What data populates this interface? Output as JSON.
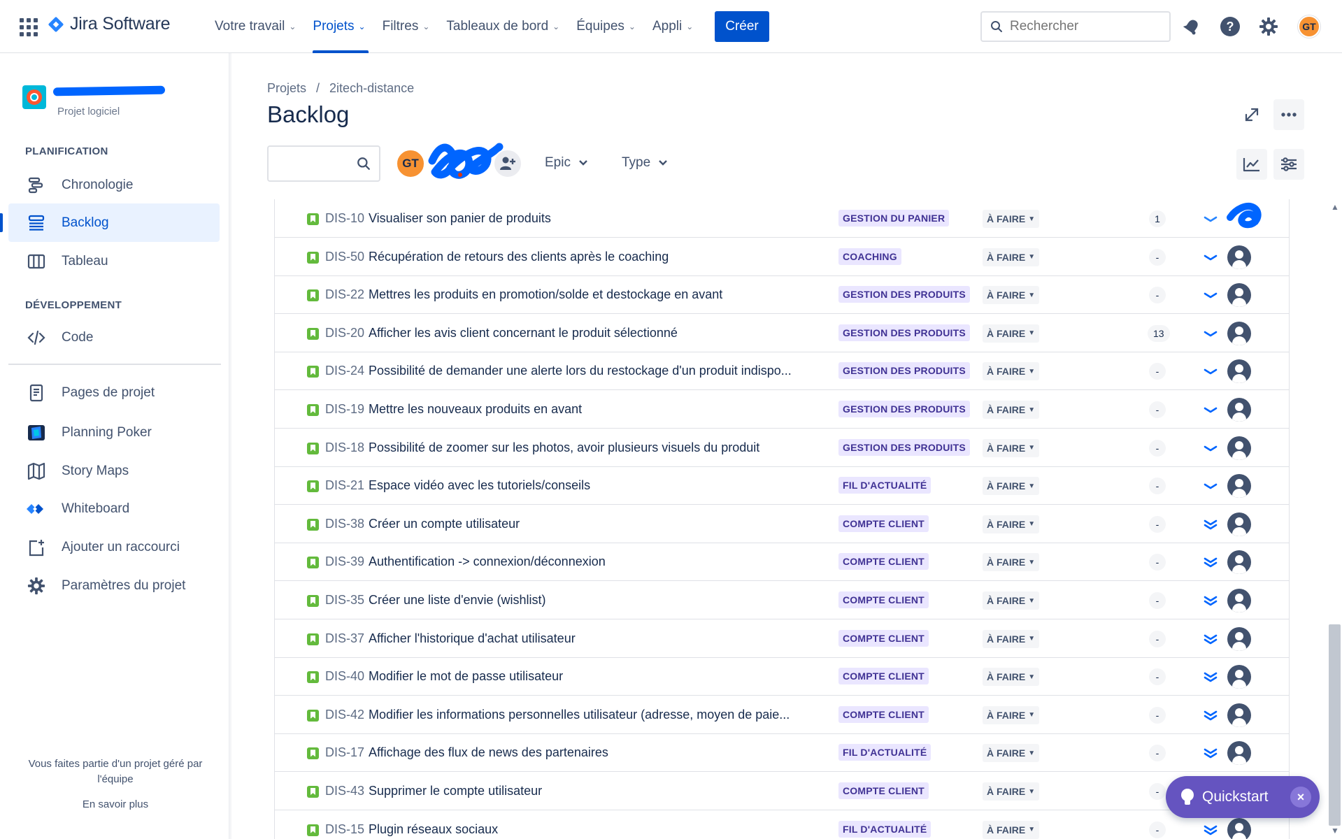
{
  "topnav": {
    "product": "Jira Software",
    "items": [
      {
        "label": "Votre travail"
      },
      {
        "label": "Projets"
      },
      {
        "label": "Filtres"
      },
      {
        "label": "Tableaux de bord"
      },
      {
        "label": "Équipes"
      },
      {
        "label": "Appli"
      }
    ],
    "create_label": "Créer",
    "search_placeholder": "Rechercher",
    "user_initials": "GT"
  },
  "sidebar": {
    "project_type": "Projet logiciel",
    "section_planning": "PLANIFICATION",
    "section_dev": "DÉVELOPPEMENT",
    "items": [
      {
        "label": "Chronologie"
      },
      {
        "label": "Backlog"
      },
      {
        "label": "Tableau"
      },
      {
        "label": "Code"
      },
      {
        "label": "Pages de projet"
      },
      {
        "label": "Planning Poker"
      },
      {
        "label": "Story Maps"
      },
      {
        "label": "Whiteboard"
      },
      {
        "label": "Ajouter un raccourci"
      },
      {
        "label": "Paramètres du projet"
      }
    ],
    "footer_text": "Vous faites partie d'un projet géré par l'équipe",
    "learn_more": "En savoir plus"
  },
  "breadcrumb": {
    "root": "Projets",
    "sep": "/",
    "project": "2itech-distance"
  },
  "page_title": "Backlog",
  "filters": {
    "avatar_initials": "GT",
    "epic_label": "Epic",
    "type_label": "Type"
  },
  "issues": [
    {
      "key": "DIS-10",
      "summary": "Visualiser son panier de produits",
      "epic": "GESTION DU PANIER",
      "status": "À FAIRE",
      "points": "1",
      "priority": "medium"
    },
    {
      "key": "DIS-50",
      "summary": "Récupération de retours des clients après le coaching",
      "epic": "COACHING",
      "status": "À FAIRE",
      "points": "-",
      "priority": "low"
    },
    {
      "key": "DIS-22",
      "summary": "Mettres les produits en promotion/solde et destockage en avant",
      "epic": "GESTION DES PRODUITS",
      "status": "À FAIRE",
      "points": "-",
      "priority": "low"
    },
    {
      "key": "DIS-20",
      "summary": "Afficher les avis client concernant le produit sélectionné",
      "epic": "GESTION DES PRODUITS",
      "status": "À FAIRE",
      "points": "13",
      "priority": "low"
    },
    {
      "key": "DIS-24",
      "summary": "Possibilité de demander une alerte lors du restockage d'un produit indispo...",
      "epic": "GESTION DES PRODUITS",
      "status": "À FAIRE",
      "points": "-",
      "priority": "low"
    },
    {
      "key": "DIS-19",
      "summary": "Mettre les nouveaux produits en avant",
      "epic": "GESTION DES PRODUITS",
      "status": "À FAIRE",
      "points": "-",
      "priority": "low"
    },
    {
      "key": "DIS-18",
      "summary": "Possibilité de zoomer sur les photos, avoir plusieurs visuels du produit",
      "epic": "GESTION DES PRODUITS",
      "status": "À FAIRE",
      "points": "-",
      "priority": "low"
    },
    {
      "key": "DIS-21",
      "summary": "Espace vidéo avec les tutoriels/conseils",
      "epic": "FIL D'ACTUALITÉ",
      "status": "À FAIRE",
      "points": "-",
      "priority": "low"
    },
    {
      "key": "DIS-38",
      "summary": "Créer un compte utilisateur",
      "epic": "COMPTE CLIENT",
      "status": "À FAIRE",
      "points": "-",
      "priority": "lowest"
    },
    {
      "key": "DIS-39",
      "summary": "Authentification -> connexion/déconnexion",
      "epic": "COMPTE CLIENT",
      "status": "À FAIRE",
      "points": "-",
      "priority": "lowest"
    },
    {
      "key": "DIS-35",
      "summary": "Créer une liste d'envie (wishlist)",
      "epic": "COMPTE CLIENT",
      "status": "À FAIRE",
      "points": "-",
      "priority": "lowest"
    },
    {
      "key": "DIS-37",
      "summary": "Afficher l'historique d'achat utilisateur",
      "epic": "COMPTE CLIENT",
      "status": "À FAIRE",
      "points": "-",
      "priority": "lowest"
    },
    {
      "key": "DIS-40",
      "summary": "Modifier le mot de passe utilisateur",
      "epic": "COMPTE CLIENT",
      "status": "À FAIRE",
      "points": "-",
      "priority": "lowest"
    },
    {
      "key": "DIS-42",
      "summary": "Modifier les informations personnelles utilisateur (adresse, moyen de paie...",
      "epic": "COMPTE CLIENT",
      "status": "À FAIRE",
      "points": "-",
      "priority": "lowest"
    },
    {
      "key": "DIS-17",
      "summary": "Affichage des flux de news des partenaires",
      "epic": "FIL D'ACTUALITÉ",
      "status": "À FAIRE",
      "points": "-",
      "priority": "lowest"
    },
    {
      "key": "DIS-43",
      "summary": "Supprimer le compte utilisateur",
      "epic": "COMPTE CLIENT",
      "status": "À FAIRE",
      "points": "-",
      "priority": "lowest"
    },
    {
      "key": "DIS-15",
      "summary": "Plugin réseaux sociaux",
      "epic": "FIL D'ACTUALITÉ",
      "status": "À FAIRE",
      "points": "-",
      "priority": "lowest"
    }
  ],
  "quickstart": {
    "label": "Quickstart",
    "close": "×"
  },
  "colors": {
    "accent": "#0052cc",
    "epic_bg": "#eae6ff",
    "epic_text": "#403294",
    "story": "#63ba3c",
    "quickstart": "#6554c0"
  }
}
